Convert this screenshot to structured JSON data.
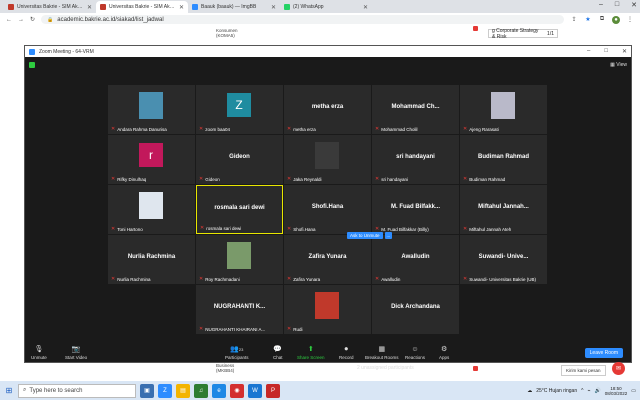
{
  "browser": {
    "tabs": [
      {
        "label": "Universitas Bakrie - SIM Akaden...",
        "color": "#c0392b",
        "active": false
      },
      {
        "label": "Universitas Bakrie - SIM Akaden...",
        "color": "#c0392b",
        "active": true
      },
      {
        "label": "Baauk (baauk) — ImgBB",
        "color": "#2d8cff",
        "active": false
      },
      {
        "label": "(2) WhatsApp",
        "color": "#25d366",
        "active": false
      }
    ],
    "url": "academic.bakrie.ac.id/siakad/list_jadwal"
  },
  "page_behind": {
    "left_text_top": [
      "Konsumen",
      "(KOMA5)"
    ],
    "left_text_bottom": [
      "Business",
      "(MKBB4)"
    ],
    "pdf_title": "g Corporate Strategy & Risk",
    "pdf_page": "1/1"
  },
  "zoom": {
    "title": "Zoom Meeting - 64-VRM",
    "view_label": "View",
    "tiles": [
      {
        "name": "Andara Rahma Danurisa",
        "kind": "photo",
        "photo": "#4a8fb0"
      },
      {
        "name": "zoom baa04",
        "kind": "avatar",
        "letter": "Z",
        "color": "#1f8ca0"
      },
      {
        "name": "metha erza",
        "kind": "name",
        "center": "metha erza"
      },
      {
        "name": "Mohammad Cholil",
        "kind": "name",
        "center": "Mohammad  Ch..."
      },
      {
        "name": "Ajeng Rarasati",
        "kind": "photo",
        "photo": "#b9b9c9"
      },
      {
        "name": "Rifky Dinulhaq",
        "kind": "avatar",
        "letter": "r",
        "color": "#c2185b"
      },
      {
        "name": "Gideon",
        "kind": "name",
        "center": "Gideon"
      },
      {
        "name": "Jaka Reynaldi",
        "kind": "photo",
        "photo": "#3a3a3a"
      },
      {
        "name": "sri handayani",
        "kind": "name",
        "center": "sri handayani"
      },
      {
        "name": "Budiman Rahmad",
        "kind": "name",
        "center": "Budiman Rahmad"
      },
      {
        "name": "Toni Hartono",
        "kind": "photo",
        "photo": "#dfe6ee"
      },
      {
        "name": "rosmala sari dewi",
        "kind": "name",
        "center": "rosmala sari dewi",
        "highlight": true
      },
      {
        "name": "Shofi.Hana",
        "kind": "name",
        "center": "Shofi.Hana"
      },
      {
        "name": "M. Fuad Bilfakkar (Billy)",
        "kind": "name",
        "center": "M. Fuad Bilfakk..."
      },
      {
        "name": "Miftahul Jannah Ateh",
        "kind": "name",
        "center": "Miftahul  Jannah..."
      },
      {
        "name": "Nurlia Rachmina",
        "kind": "name",
        "center": "Nurlia Rachmina"
      },
      {
        "name": "Roy Rachmadani",
        "kind": "photo",
        "photo": "#7a9a6a"
      },
      {
        "name": "Zafira Yunara",
        "kind": "name",
        "center": "Zafira Yunara"
      },
      {
        "name": "Awalludin",
        "kind": "name",
        "center": "Awalludin"
      },
      {
        "name": "Suwandi- Universitas Bakrie (UB)",
        "kind": "name",
        "center": "Suwandi-  Unive..."
      },
      {
        "name": "NUGRAHANTI KHAIRANI A...",
        "kind": "name",
        "center": "NUGRAHANTI  K..."
      },
      {
        "name": "Rudi",
        "kind": "photo",
        "photo": "#c0392b"
      },
      {
        "name": "",
        "kind": "name",
        "center": "Dick Archandana"
      }
    ],
    "ask_unmute": "Ask to Unmute",
    "more": "...",
    "unassigned": "2 unassigned participants",
    "toolbar": {
      "unmute": "Unmute",
      "start_video": "Start Video",
      "participants": "Participants",
      "participants_count": "23",
      "chat": "Chat",
      "share_screen": "Share Screen",
      "record": "Record",
      "breakout": "Breakout Rooms",
      "reactions": "Reactions",
      "apps": "Apps",
      "leave": "Leave Room"
    }
  },
  "chat_popup": "Kirim kami pesan",
  "taskbar": {
    "search_placeholder": "Type here to search",
    "weather": "25°C  Hujan ringan",
    "time": "18:50",
    "date": "08/03/2022"
  },
  "colors": {
    "accent": "#2d8cff",
    "green": "#2ecc40",
    "highlight": "#e8e600",
    "red": "#e53935"
  }
}
